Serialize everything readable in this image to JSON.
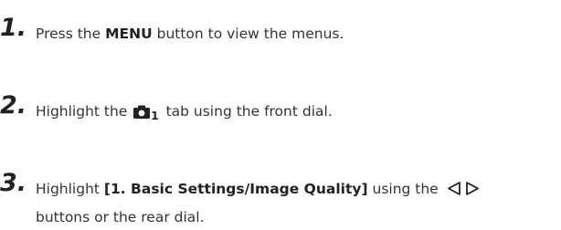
{
  "steps": [
    {
      "number": "1.",
      "pre": "Press the ",
      "bold": "MENU",
      "post": " button to view the menus."
    },
    {
      "number": "2.",
      "pre": "Highlight the ",
      "icon": "camera-icon",
      "icon_sub": "1",
      "post": " tab using the front dial."
    },
    {
      "number": "3.",
      "pre": "Highlight ",
      "bold": "[1. Basic Settings/Image Quality]",
      "mid": " using the ",
      "icon": "left-right-arrow-icon",
      "line2": "buttons or the rear dial."
    }
  ],
  "colors": {
    "text": "#333333",
    "bold": "#222222"
  }
}
